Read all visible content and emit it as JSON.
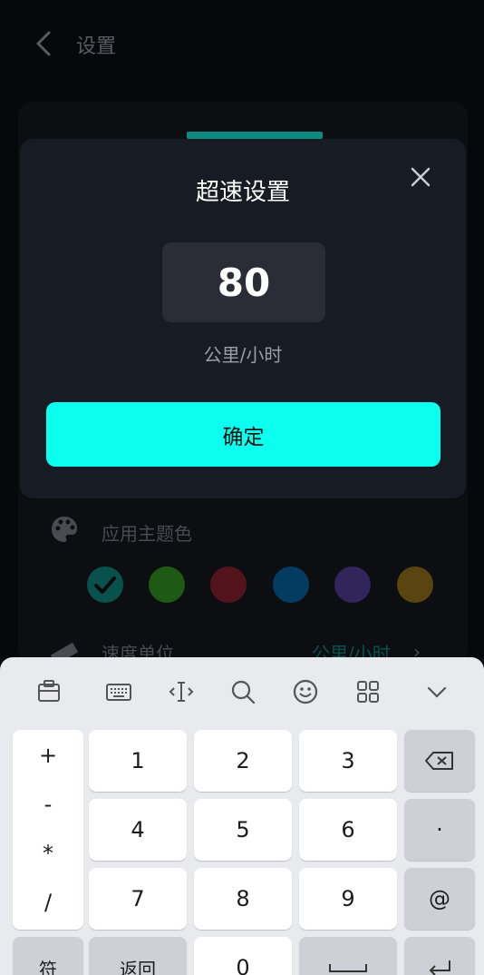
{
  "header": {
    "title": "设置"
  },
  "settings": {
    "theme_label": "应用主题色",
    "theme_colors": [
      "#0d7d76",
      "#2f8a1f",
      "#7f2028",
      "#075c95",
      "#4c3a8e",
      "#8a6a1b"
    ],
    "speed_unit_label": "速度单位",
    "speed_unit_value": "公里/小时",
    "arrow": "›"
  },
  "dialog": {
    "title": "超速设置",
    "value": "80",
    "unit": "公里/小时",
    "confirm_label": "确定",
    "accent_color": "#0bffee"
  },
  "keyboard": {
    "symbols": [
      "+",
      "-",
      "*",
      "/"
    ],
    "keys": {
      "k1": "1",
      "k2": "2",
      "k3": "3",
      "k4": "4",
      "k5": "5",
      "k6": "6",
      "k7": "7",
      "k8": "8",
      "k9": "9",
      "k0": "0",
      "dot": "·",
      "at": "@",
      "fu": "符",
      "back": "返回"
    },
    "toolbar_icons": [
      "clipboard-icon",
      "keyboard-icon",
      "cursor-icon",
      "search-icon",
      "emoji-icon",
      "apps-icon",
      "collapse-icon"
    ]
  }
}
